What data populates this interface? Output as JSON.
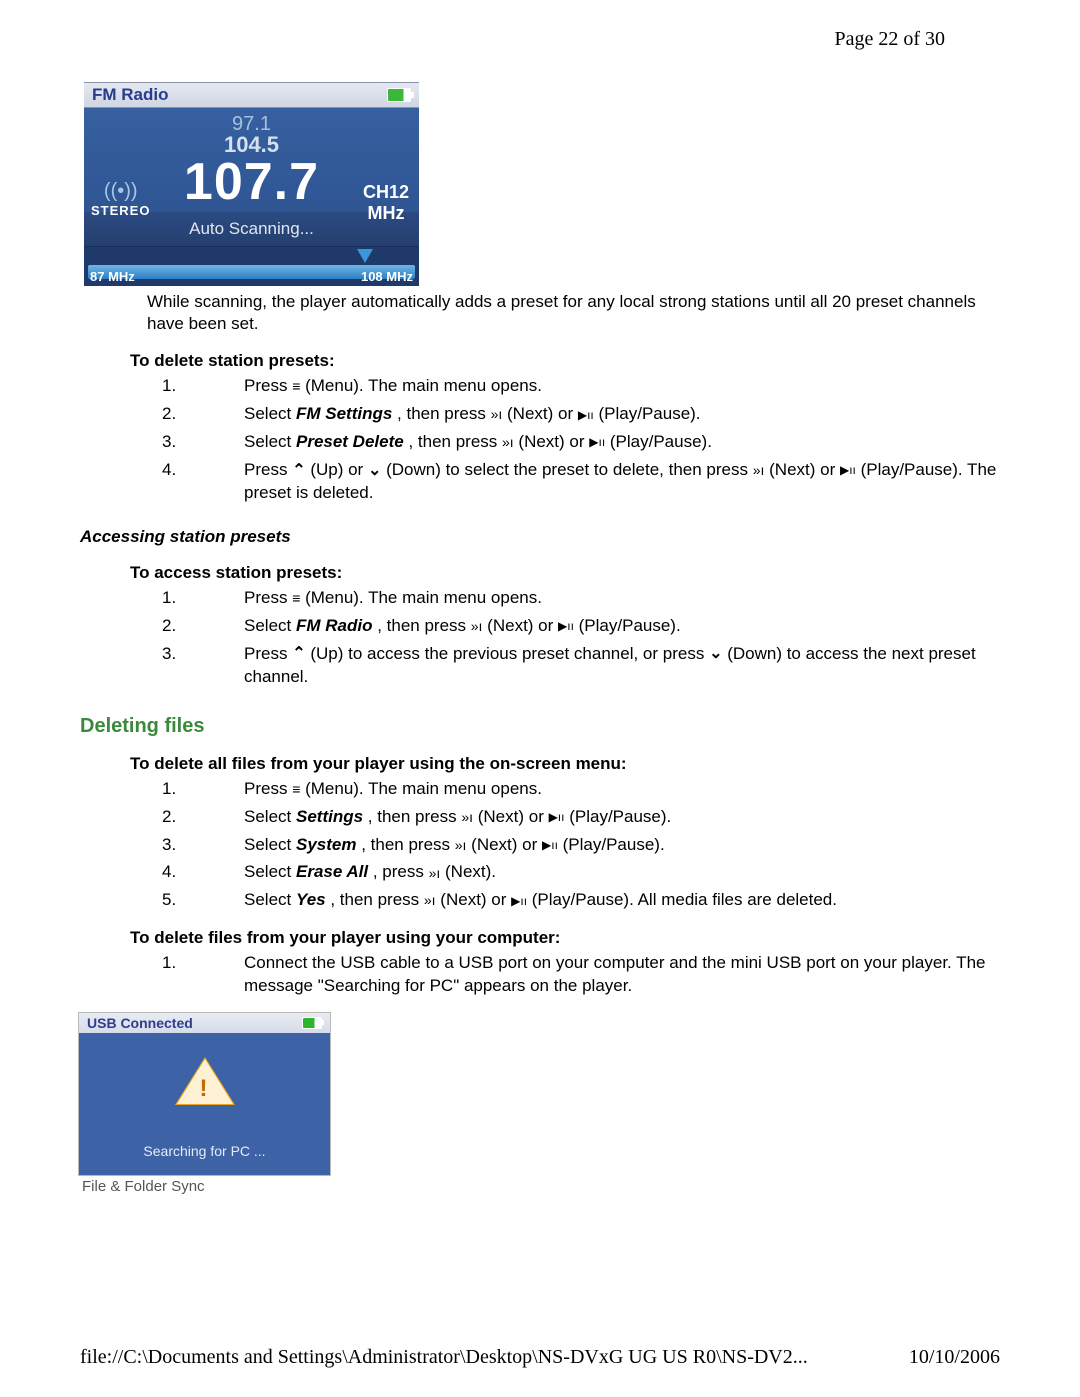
{
  "page_num": "Page 22 of 30",
  "footer": {
    "left": "file://C:\\Documents and Settings\\Administrator\\Desktop\\NS-DVxG UG US R0\\NS-DV2...",
    "right": "10/10/2006"
  },
  "fm_radio": {
    "title": "FM Radio",
    "freq_prev2": "97.1",
    "freq_prev1": "104.5",
    "freq_main": "107.7",
    "stereo": "STEREO",
    "channel": "CH12",
    "unit": "MHz",
    "scanning": "Auto Scanning...",
    "scale_low": "87 MHz",
    "scale_high": "108 MHz"
  },
  "scan_note": "While scanning, the player automatically adds a preset for any local strong stations until all 20 preset channels have been set.",
  "delete_presets": {
    "heading": "To delete station presets:",
    "steps": {
      "s1_a": "Press ",
      "s1_b": " (Menu). The main menu opens.",
      "s2_a": "Select ",
      "s2_opt": "FM Settings",
      "s2_b": " , then press ",
      "s2_c": " (Next) or ",
      "s2_d": " (Play/Pause).",
      "s3_a": "Select ",
      "s3_opt": "Preset Delete",
      "s3_b": " , then press ",
      "s3_c": " (Next) or ",
      "s3_d": " (Play/Pause).",
      "s4_a": "Press ",
      "s4_b": " (Up) or ",
      "s4_c": " (Down) to select the preset to delete, then press ",
      "s4_d": " (Next) or ",
      "s4_e": " (Play/Pause). The preset is deleted."
    }
  },
  "access_section": "Accessing station presets",
  "access_presets": {
    "heading": "To access station presets:",
    "steps": {
      "s1_a": "Press ",
      "s1_b": " (Menu). The main menu opens.",
      "s2_a": "Select ",
      "s2_opt": "FM Radio",
      "s2_b": " , then press ",
      "s2_c": " (Next) or ",
      "s2_d": " (Play/Pause).",
      "s3_a": "Press ",
      "s3_b": " (Up) to access the previous preset channel, or press ",
      "s3_c": " (Down) to access the next preset channel."
    }
  },
  "deleting_files": "Deleting files",
  "delete_onscreen": {
    "heading": "To delete all files from your player using the on-screen menu:",
    "steps": {
      "s1_a": "Press ",
      "s1_b": " (Menu). The main menu opens.",
      "s2_a": "Select ",
      "s2_opt": "Settings",
      "s2_b": " , then press ",
      "s2_c": " (Next) or ",
      "s2_d": " (Play/Pause).",
      "s3_a": "Select ",
      "s3_opt": "System",
      "s3_b": " , then press ",
      "s3_c": " (Next) or ",
      "s3_d": " (Play/Pause).",
      "s4_a": "Select ",
      "s4_opt": "Erase All",
      "s4_b": " , press ",
      "s4_c": " (Next).",
      "s5_a": "Select ",
      "s5_opt": "Yes",
      "s5_b": " , then press ",
      "s5_c": " (Next) or ",
      "s5_d": " (Play/Pause). All media files are deleted."
    }
  },
  "delete_computer": {
    "heading": "To delete files from your player using your computer:",
    "s1": "Connect the USB cable to a USB port on your computer and the mini USB port on your player. The message \"Searching for PC\" appears on the player."
  },
  "usb": {
    "title": "USB Connected",
    "msg": "Searching for PC ...",
    "caption": "File & Folder Sync"
  }
}
